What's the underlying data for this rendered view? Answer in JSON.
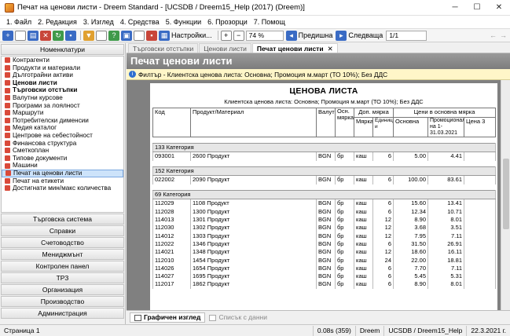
{
  "window": {
    "title": "Печат на ценови листи - Dreem Standard - [UCSDB / Dreem15_Help (2017) (Dreem)]",
    "minimize": "─",
    "maximize": "☐",
    "close": "✕"
  },
  "menu": [
    "1. Файл",
    "2. Редакция",
    "3. Изглед",
    "4. Средства",
    "5. Функции",
    "6. Прозорци",
    "7. Помощ"
  ],
  "toolbar": {
    "settings_label": "Настройки...",
    "zoom_value": "74 %",
    "prev_label": "Предишна",
    "next_label": "Следваща",
    "page_value": "1/1"
  },
  "sidebar": {
    "header": "Номенклатури",
    "items": [
      {
        "label": "Контрагенти",
        "bold": false
      },
      {
        "label": "Продукти и материали",
        "bold": false
      },
      {
        "label": "Дълготрайни активи",
        "bold": false
      },
      {
        "label": "Ценови листи",
        "bold": true
      },
      {
        "label": "Търговски отстъпки",
        "bold": true
      },
      {
        "label": "Валутни курсове",
        "bold": false
      },
      {
        "label": "Програми за лоялност",
        "bold": false
      },
      {
        "label": "Маршрути",
        "bold": false
      },
      {
        "label": "Потребителски дименсии",
        "bold": false
      },
      {
        "label": "Медия каталог",
        "bold": false
      },
      {
        "label": "Центрове на себестойност",
        "bold": false
      },
      {
        "label": "Финансова структура",
        "bold": false
      },
      {
        "label": "Сметкоплан",
        "bold": false
      },
      {
        "label": "Типове документи",
        "bold": false
      },
      {
        "label": "Машини",
        "bold": false
      },
      {
        "label": "Печат на ценови листи",
        "bold": false,
        "selected": true
      },
      {
        "label": "Печат на етикети",
        "bold": false
      },
      {
        "label": "Достигнати мин/макс количества",
        "bold": false
      }
    ],
    "sections": [
      "Търговска система",
      "Справки",
      "Счетоводство",
      "Мениджмънт",
      "Контролен панел",
      "ТРЗ",
      "Организация",
      "Производство",
      "Администрация"
    ]
  },
  "doc_tabs": [
    {
      "label": "Търговски отстъпки",
      "active": false
    },
    {
      "label": "Ценови листи",
      "active": false
    },
    {
      "label": "Печат ценови листи",
      "active": true,
      "close": "✕"
    }
  ],
  "page_title": "Печат ценови листи",
  "filter_text": "Филтър - Клиентска ценова листа: Основна; Промоция м.март (ТО 10%); Без ДДС",
  "report": {
    "title": "ЦЕНОВА ЛИСТА",
    "subtitle": "Клиентска ценова листа: Основна; Промоция м.март (ТО 10%); Без ДДС",
    "headers": {
      "code": "Код",
      "product": "Продукт/Материал",
      "currency": "Валута",
      "base_unit": "Осн. мярка",
      "extra_unit": "Доп. мярка",
      "unit": "Мярка",
      "units": "Единиц и",
      "price_group": "Цени в основна мярка",
      "base": "Основна",
      "promo": "Промоционал на 1-31.03.2021",
      "price3": "Цена 3"
    },
    "categories": [
      {
        "name": "133 Категория",
        "rows": [
          {
            "code": "093001",
            "product": "2600 Продукт",
            "cur": "BGN",
            "bu": "бр",
            "eu": "каш",
            "qty": "6",
            "base": "5.00",
            "promo": "4.41"
          }
        ]
      },
      {
        "name": "152 Категория",
        "rows": [
          {
            "code": "022002",
            "product": "2090 Продукт",
            "cur": "BGN",
            "bu": "бр",
            "eu": "каш",
            "qty": "6",
            "base": "100.00",
            "promo": "83.61"
          }
        ]
      },
      {
        "name": "69 Категория",
        "rows": [
          {
            "code": "112029",
            "product": "1108 Продукт",
            "cur": "BGN",
            "bu": "бр",
            "eu": "каш",
            "qty": "6",
            "base": "15.60",
            "promo": "13.41"
          },
          {
            "code": "112028",
            "product": "1300 Продукт",
            "cur": "BGN",
            "bu": "бр",
            "eu": "каш",
            "qty": "6",
            "base": "12.34",
            "promo": "10.71"
          },
          {
            "code": "114013",
            "product": "1301 Продукт",
            "cur": "BGN",
            "bu": "бр",
            "eu": "каш",
            "qty": "12",
            "base": "8.90",
            "promo": "8.01"
          },
          {
            "code": "112030",
            "product": "1302 Продукт",
            "cur": "BGN",
            "bu": "бр",
            "eu": "каш",
            "qty": "12",
            "base": "3.68",
            "promo": "3.51"
          },
          {
            "code": "114012",
            "product": "1303 Продукт",
            "cur": "BGN",
            "bu": "бр",
            "eu": "каш",
            "qty": "12",
            "base": "7.95",
            "promo": "7.11"
          },
          {
            "code": "112022",
            "product": "1346 Продукт",
            "cur": "BGN",
            "bu": "бр",
            "eu": "каш",
            "qty": "6",
            "base": "31.50",
            "promo": "26.91"
          },
          {
            "code": "114021",
            "product": "1348 Продукт",
            "cur": "BGN",
            "bu": "бр",
            "eu": "каш",
            "qty": "12",
            "base": "18.60",
            "promo": "16.11"
          },
          {
            "code": "112010",
            "product": "1454 Продукт",
            "cur": "BGN",
            "bu": "бр",
            "eu": "каш",
            "qty": "24",
            "base": "22.00",
            "promo": "18.81"
          },
          {
            "code": "114026",
            "product": "1654 Продукт",
            "cur": "BGN",
            "bu": "бр",
            "eu": "каш",
            "qty": "6",
            "base": "7.70",
            "promo": "7.11"
          },
          {
            "code": "114027",
            "product": "1695 Продукт",
            "cur": "BGN",
            "bu": "бр",
            "eu": "каш",
            "qty": "6",
            "base": "5.45",
            "promo": "5.31"
          },
          {
            "code": "112017",
            "product": "1862 Продукт",
            "cur": "BGN",
            "bu": "бр",
            "eu": "каш",
            "qty": "6",
            "base": "8.90",
            "promo": "8.01"
          }
        ]
      }
    ]
  },
  "bottom_tabs": [
    {
      "label": "Графичен изглед",
      "active": true
    },
    {
      "label": "Списък с данни",
      "active": false
    }
  ],
  "status": {
    "page": "Страница 1",
    "timing": "0.08s (359)",
    "user": "Dreem",
    "db": "UCSDB / Dreem15_Help",
    "date": "22.3.2021 г."
  }
}
